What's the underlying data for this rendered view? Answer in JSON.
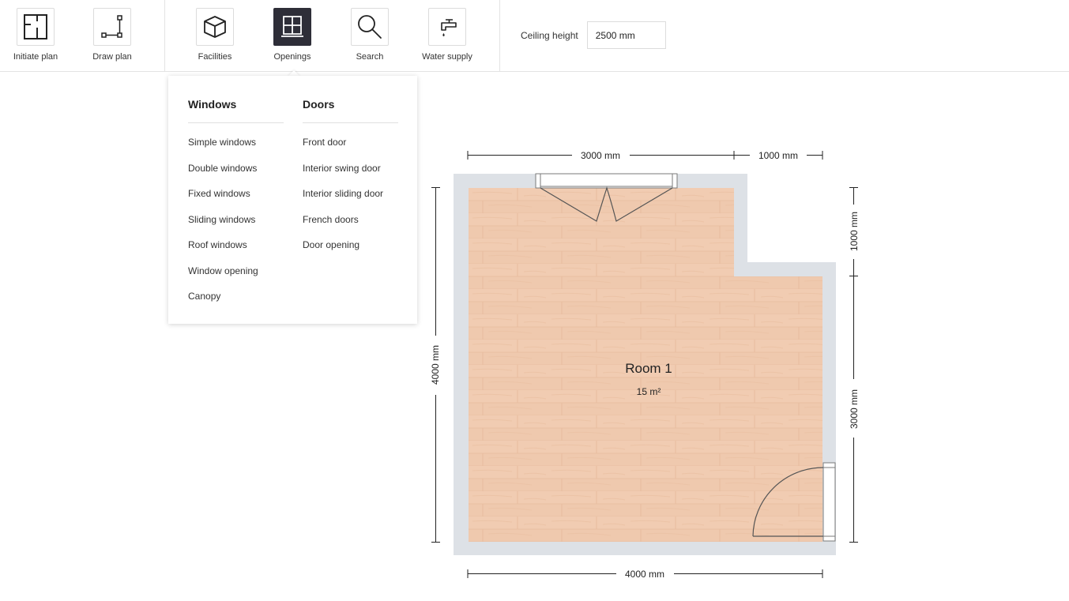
{
  "toolbar": {
    "tools": [
      {
        "label": "Initiate plan",
        "icon": "initiate-plan-icon"
      },
      {
        "label": "Draw plan",
        "icon": "draw-plan-icon"
      },
      {
        "label": "Facilities",
        "icon": "cube-icon"
      },
      {
        "label": "Openings",
        "icon": "window-icon",
        "active": true
      },
      {
        "label": "Search",
        "icon": "search-icon"
      },
      {
        "label": "Water supply",
        "icon": "faucet-icon"
      }
    ],
    "ceiling": {
      "label": "Ceiling height",
      "value": "2500 mm"
    }
  },
  "openings_menu": {
    "windows": {
      "title": "Windows",
      "items": [
        "Simple windows",
        "Double windows",
        "Fixed windows",
        "Sliding windows",
        "Roof windows",
        "Window opening",
        "Canopy"
      ]
    },
    "doors": {
      "title": "Doors",
      "items": [
        "Front door",
        "Interior swing door",
        "Interior sliding door",
        "French doors",
        "Door opening"
      ]
    }
  },
  "plan": {
    "room": {
      "name": "Room 1",
      "area": "15 m²"
    },
    "dimensions": {
      "top_left": "3000 mm",
      "top_right": "1000 mm",
      "bottom": "4000 mm",
      "left": "4000 mm",
      "right_top": "1000 mm",
      "right_bottom": "3000 mm"
    },
    "colors": {
      "wall": "#dde1e6",
      "floor": "#efc9ae",
      "active_tool": "#2e2e38"
    }
  }
}
